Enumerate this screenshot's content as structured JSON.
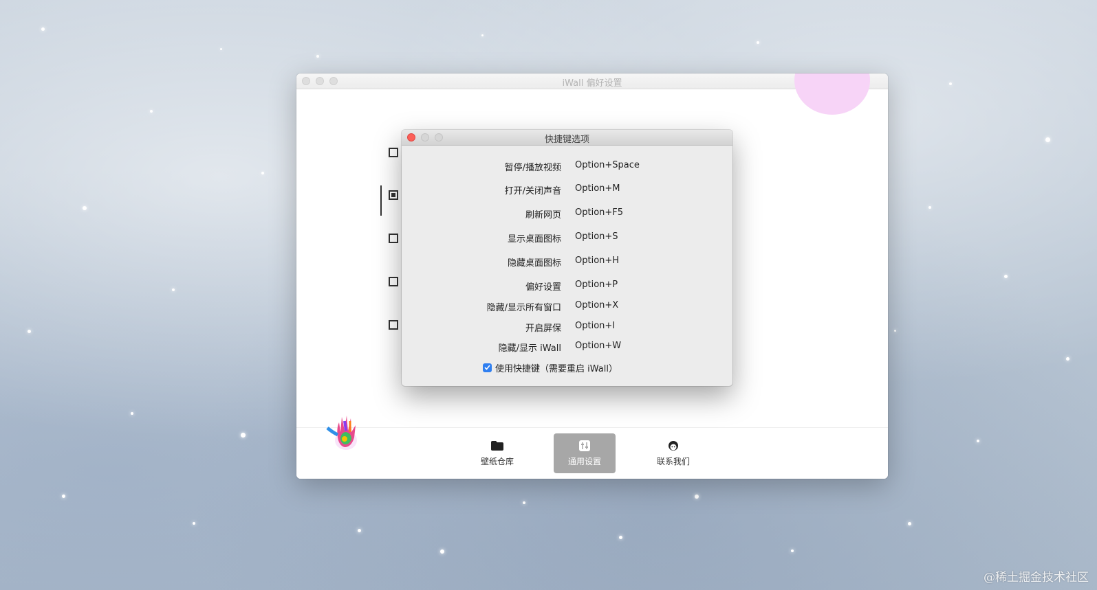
{
  "main_window": {
    "title": "iWall 偏好设置",
    "checkboxes": [
      false,
      true,
      false,
      false,
      false
    ]
  },
  "nav": {
    "items": [
      {
        "label": "壁纸仓库",
        "icon": "folder-icon",
        "active": false
      },
      {
        "label": "通用设置",
        "icon": "settings-sliders-icon",
        "active": true
      },
      {
        "label": "联系我们",
        "icon": "contact-face-icon",
        "active": false
      }
    ]
  },
  "dialog": {
    "title": "快捷键选项",
    "shortcuts": [
      {
        "label": "暂停/播放视频",
        "key": "Option+Space"
      },
      {
        "label": "打开/关闭声音",
        "key": "Option+M"
      },
      {
        "label": "刷新网页",
        "key": "Option+F5"
      },
      {
        "label": "显示桌面图标",
        "key": "Option+S"
      },
      {
        "label": "隐藏桌面图标",
        "key": "Option+H"
      },
      {
        "label": "偏好设置",
        "key": "Option+P"
      },
      {
        "label": "隐藏/显示所有窗口",
        "key": "Option+X"
      },
      {
        "label": "开启屏保",
        "key": "Option+I"
      },
      {
        "label": "隐藏/显示 iWall",
        "key": "Option+W"
      }
    ],
    "use_shortcut": {
      "label": "使用快捷键（需要重启 iWall）",
      "checked": true
    }
  },
  "watermark": "@稀土掘金技术社区",
  "colors": {
    "close_red": "#fc5f57",
    "checkbox_blue": "#2f7ff0",
    "active_nav": "#a7a7a7"
  }
}
